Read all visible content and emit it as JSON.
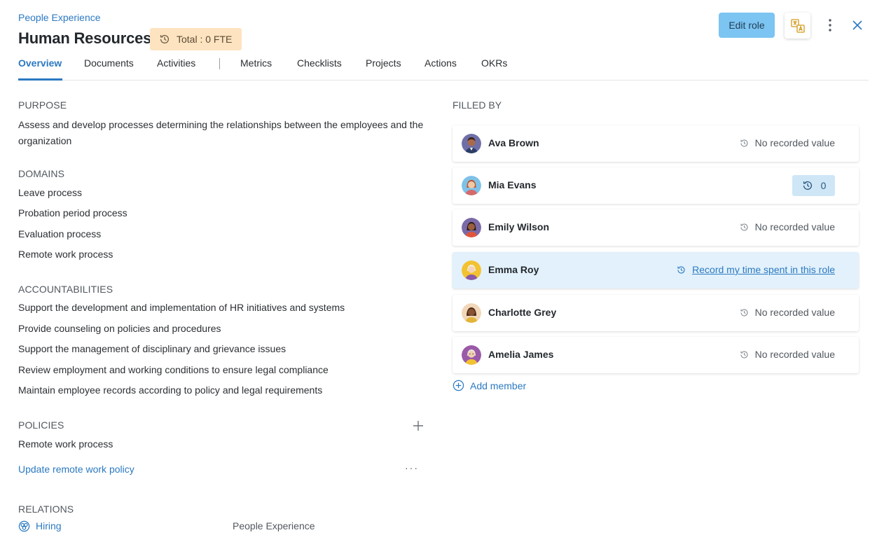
{
  "header": {
    "breadcrumb": "People Experience",
    "title": "Human Resources",
    "fte_badge": "Total : 0 FTE",
    "edit_label": "Edit role",
    "icons": {
      "fte": "history-icon",
      "translate": "translate-icon",
      "more": "more-vertical-icon",
      "close": "close-icon"
    }
  },
  "tabs": [
    {
      "label": "Overview",
      "active": true
    },
    {
      "label": "Documents"
    },
    {
      "label": "Activities"
    },
    {
      "label": "Metrics"
    },
    {
      "label": "Checklists"
    },
    {
      "label": "Projects"
    },
    {
      "label": "Actions"
    },
    {
      "label": "OKRs"
    }
  ],
  "purpose": {
    "heading": "PURPOSE",
    "text": "Assess and develop processes determining the relationships between the employees and the organization"
  },
  "domains": {
    "heading": "DOMAINS",
    "items": [
      "Leave process",
      "Probation period process",
      "Evaluation process",
      "Remote work process"
    ]
  },
  "accountabilities": {
    "heading": "ACCOUNTABILITIES",
    "items": [
      "Support the development and implementation of HR initiatives and systems",
      "Provide counseling on policies and procedures",
      "Support the management of disciplinary and grievance issues",
      "Review employment and working conditions to ensure legal compliance",
      "Maintain employee records according to policy and legal requirements"
    ]
  },
  "policies": {
    "heading": "POLICIES",
    "item": "Remote work process",
    "link": "Update remote work policy",
    "more": "···"
  },
  "relations": {
    "heading": "RELATIONS",
    "items": [
      {
        "name": "Hiring",
        "parent": "People Experience"
      }
    ]
  },
  "filled_by": {
    "heading": "FILLED BY",
    "members": [
      {
        "name": "Ava Brown",
        "status": "No recorded value"
      },
      {
        "name": "Mia Evans",
        "value": "0"
      },
      {
        "name": "Emily Wilson",
        "status": "No recorded value"
      },
      {
        "name": "Emma Roy",
        "record_link": "Record my time spent in this role"
      },
      {
        "name": "Charlotte Grey",
        "status": "No recorded value"
      },
      {
        "name": "Amelia James",
        "status": "No recorded value"
      }
    ],
    "add_member": "Add member"
  },
  "colors": {
    "accent": "#2b79c2",
    "edit_button": "#7cc4f2",
    "fte_badge": "#fde3c0",
    "highlight_row": "#e2f1fb"
  }
}
